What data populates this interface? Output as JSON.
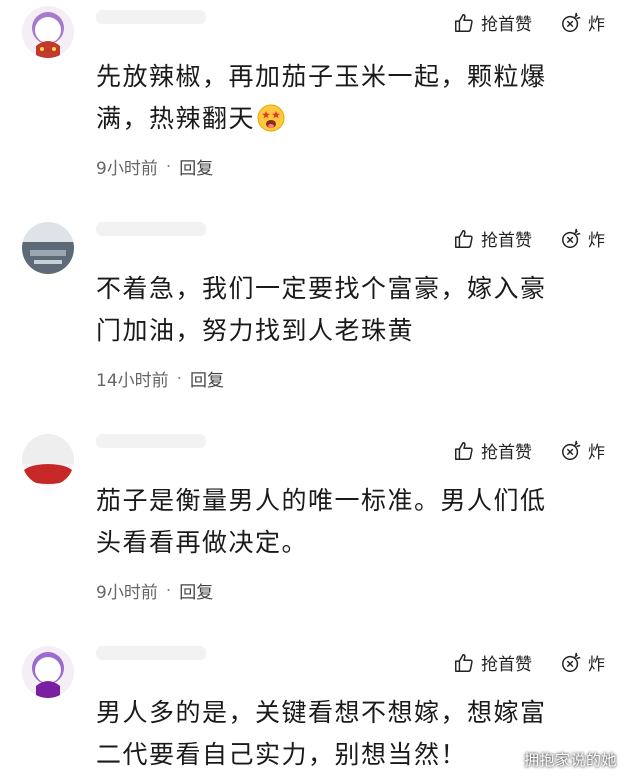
{
  "actions": {
    "like_label": "抢首赞",
    "explode_label": "炸"
  },
  "comments": [
    {
      "text_line1": "先放辣椒，再加茄子玉米一起，颗粒爆",
      "text_line2": "满，热辣翻天",
      "time": "9小时前",
      "reply": "回复"
    },
    {
      "text_line1": "不着急，我们一定要找个富豪，嫁入豪",
      "text_line2": "门加油，努力找到人老珠黄",
      "time": "14小时前",
      "reply": "回复"
    },
    {
      "text_line1": "茄子是衡量男人的唯一标准。男人们低",
      "text_line2": "头看看再做决定。",
      "time": "9小时前",
      "reply": "回复"
    },
    {
      "text_line1": "男人多的是，关键看想不想嫁，想嫁富",
      "text_line2": "二代要看自己实力，别想当然！",
      "time": "",
      "reply": ""
    }
  ],
  "watermark": "拥抱家说的她",
  "icons": {
    "like": "thumbs-up-icon",
    "explode": "bomb-icon",
    "emoji": "starstruck-emoji-icon"
  }
}
